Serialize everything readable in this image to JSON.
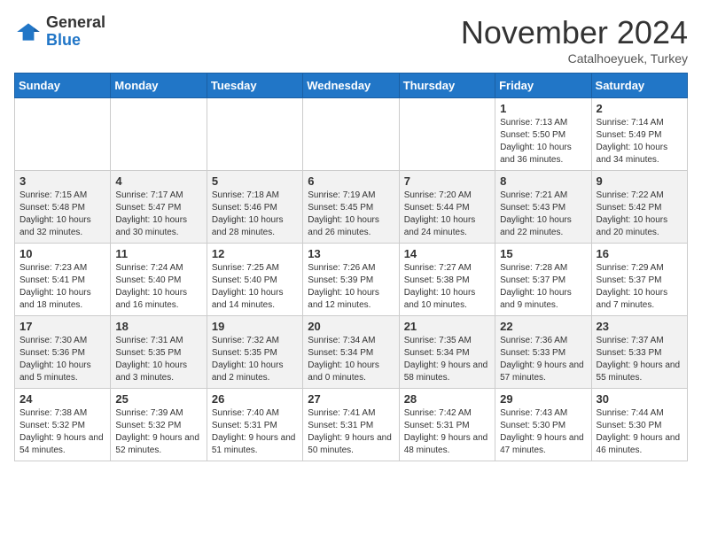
{
  "logo": {
    "general": "General",
    "blue": "Blue"
  },
  "header": {
    "month": "November 2024",
    "location": "Catalhoeyuek, Turkey"
  },
  "weekdays": [
    "Sunday",
    "Monday",
    "Tuesday",
    "Wednesday",
    "Thursday",
    "Friday",
    "Saturday"
  ],
  "weeks": [
    [
      {
        "day": "",
        "info": ""
      },
      {
        "day": "",
        "info": ""
      },
      {
        "day": "",
        "info": ""
      },
      {
        "day": "",
        "info": ""
      },
      {
        "day": "",
        "info": ""
      },
      {
        "day": "1",
        "info": "Sunrise: 7:13 AM\nSunset: 5:50 PM\nDaylight: 10 hours and 36 minutes."
      },
      {
        "day": "2",
        "info": "Sunrise: 7:14 AM\nSunset: 5:49 PM\nDaylight: 10 hours and 34 minutes."
      }
    ],
    [
      {
        "day": "3",
        "info": "Sunrise: 7:15 AM\nSunset: 5:48 PM\nDaylight: 10 hours and 32 minutes."
      },
      {
        "day": "4",
        "info": "Sunrise: 7:17 AM\nSunset: 5:47 PM\nDaylight: 10 hours and 30 minutes."
      },
      {
        "day": "5",
        "info": "Sunrise: 7:18 AM\nSunset: 5:46 PM\nDaylight: 10 hours and 28 minutes."
      },
      {
        "day": "6",
        "info": "Sunrise: 7:19 AM\nSunset: 5:45 PM\nDaylight: 10 hours and 26 minutes."
      },
      {
        "day": "7",
        "info": "Sunrise: 7:20 AM\nSunset: 5:44 PM\nDaylight: 10 hours and 24 minutes."
      },
      {
        "day": "8",
        "info": "Sunrise: 7:21 AM\nSunset: 5:43 PM\nDaylight: 10 hours and 22 minutes."
      },
      {
        "day": "9",
        "info": "Sunrise: 7:22 AM\nSunset: 5:42 PM\nDaylight: 10 hours and 20 minutes."
      }
    ],
    [
      {
        "day": "10",
        "info": "Sunrise: 7:23 AM\nSunset: 5:41 PM\nDaylight: 10 hours and 18 minutes."
      },
      {
        "day": "11",
        "info": "Sunrise: 7:24 AM\nSunset: 5:40 PM\nDaylight: 10 hours and 16 minutes."
      },
      {
        "day": "12",
        "info": "Sunrise: 7:25 AM\nSunset: 5:40 PM\nDaylight: 10 hours and 14 minutes."
      },
      {
        "day": "13",
        "info": "Sunrise: 7:26 AM\nSunset: 5:39 PM\nDaylight: 10 hours and 12 minutes."
      },
      {
        "day": "14",
        "info": "Sunrise: 7:27 AM\nSunset: 5:38 PM\nDaylight: 10 hours and 10 minutes."
      },
      {
        "day": "15",
        "info": "Sunrise: 7:28 AM\nSunset: 5:37 PM\nDaylight: 10 hours and 9 minutes."
      },
      {
        "day": "16",
        "info": "Sunrise: 7:29 AM\nSunset: 5:37 PM\nDaylight: 10 hours and 7 minutes."
      }
    ],
    [
      {
        "day": "17",
        "info": "Sunrise: 7:30 AM\nSunset: 5:36 PM\nDaylight: 10 hours and 5 minutes."
      },
      {
        "day": "18",
        "info": "Sunrise: 7:31 AM\nSunset: 5:35 PM\nDaylight: 10 hours and 3 minutes."
      },
      {
        "day": "19",
        "info": "Sunrise: 7:32 AM\nSunset: 5:35 PM\nDaylight: 10 hours and 2 minutes."
      },
      {
        "day": "20",
        "info": "Sunrise: 7:34 AM\nSunset: 5:34 PM\nDaylight: 10 hours and 0 minutes."
      },
      {
        "day": "21",
        "info": "Sunrise: 7:35 AM\nSunset: 5:34 PM\nDaylight: 9 hours and 58 minutes."
      },
      {
        "day": "22",
        "info": "Sunrise: 7:36 AM\nSunset: 5:33 PM\nDaylight: 9 hours and 57 minutes."
      },
      {
        "day": "23",
        "info": "Sunrise: 7:37 AM\nSunset: 5:33 PM\nDaylight: 9 hours and 55 minutes."
      }
    ],
    [
      {
        "day": "24",
        "info": "Sunrise: 7:38 AM\nSunset: 5:32 PM\nDaylight: 9 hours and 54 minutes."
      },
      {
        "day": "25",
        "info": "Sunrise: 7:39 AM\nSunset: 5:32 PM\nDaylight: 9 hours and 52 minutes."
      },
      {
        "day": "26",
        "info": "Sunrise: 7:40 AM\nSunset: 5:31 PM\nDaylight: 9 hours and 51 minutes."
      },
      {
        "day": "27",
        "info": "Sunrise: 7:41 AM\nSunset: 5:31 PM\nDaylight: 9 hours and 50 minutes."
      },
      {
        "day": "28",
        "info": "Sunrise: 7:42 AM\nSunset: 5:31 PM\nDaylight: 9 hours and 48 minutes."
      },
      {
        "day": "29",
        "info": "Sunrise: 7:43 AM\nSunset: 5:30 PM\nDaylight: 9 hours and 47 minutes."
      },
      {
        "day": "30",
        "info": "Sunrise: 7:44 AM\nSunset: 5:30 PM\nDaylight: 9 hours and 46 minutes."
      }
    ]
  ]
}
